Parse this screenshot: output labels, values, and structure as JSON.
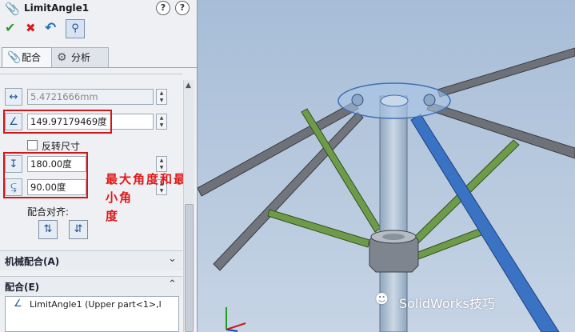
{
  "property_manager": {
    "title": "LimitAngle1",
    "help_symbol": "?",
    "toolbar": {
      "ok_icon": "checkmark-icon",
      "cancel_icon": "x-icon",
      "undo_icon": "undo-icon",
      "pin_icon": "pushpin-icon"
    },
    "tabs": [
      {
        "label": "配合",
        "icon": "paperclip-icon",
        "active": true
      },
      {
        "label": "分析",
        "icon": "gears-icon",
        "active": false
      }
    ],
    "fields": {
      "distance_value": "5.4721666mm",
      "angle_value": "149.97179469度",
      "flip_dimension_label": "反转尺寸",
      "max_angle_value": "180.00度",
      "min_angle_value": "90.00度"
    },
    "mate_alignment_label": "配合对齐:",
    "sections": {
      "mechanical_mates": "机械配合(A)",
      "mates": "配合(E)"
    },
    "mates_list": [
      {
        "label": "LimitAngle1 (Upper part<1>,l"
      }
    ]
  },
  "annotation": {
    "text_line1": "最大角度和最小角",
    "text_line2": "度",
    "color": "#e01818"
  },
  "viewport": {
    "watermark": "SolidWorks技巧",
    "background": "#b3c7dd"
  }
}
